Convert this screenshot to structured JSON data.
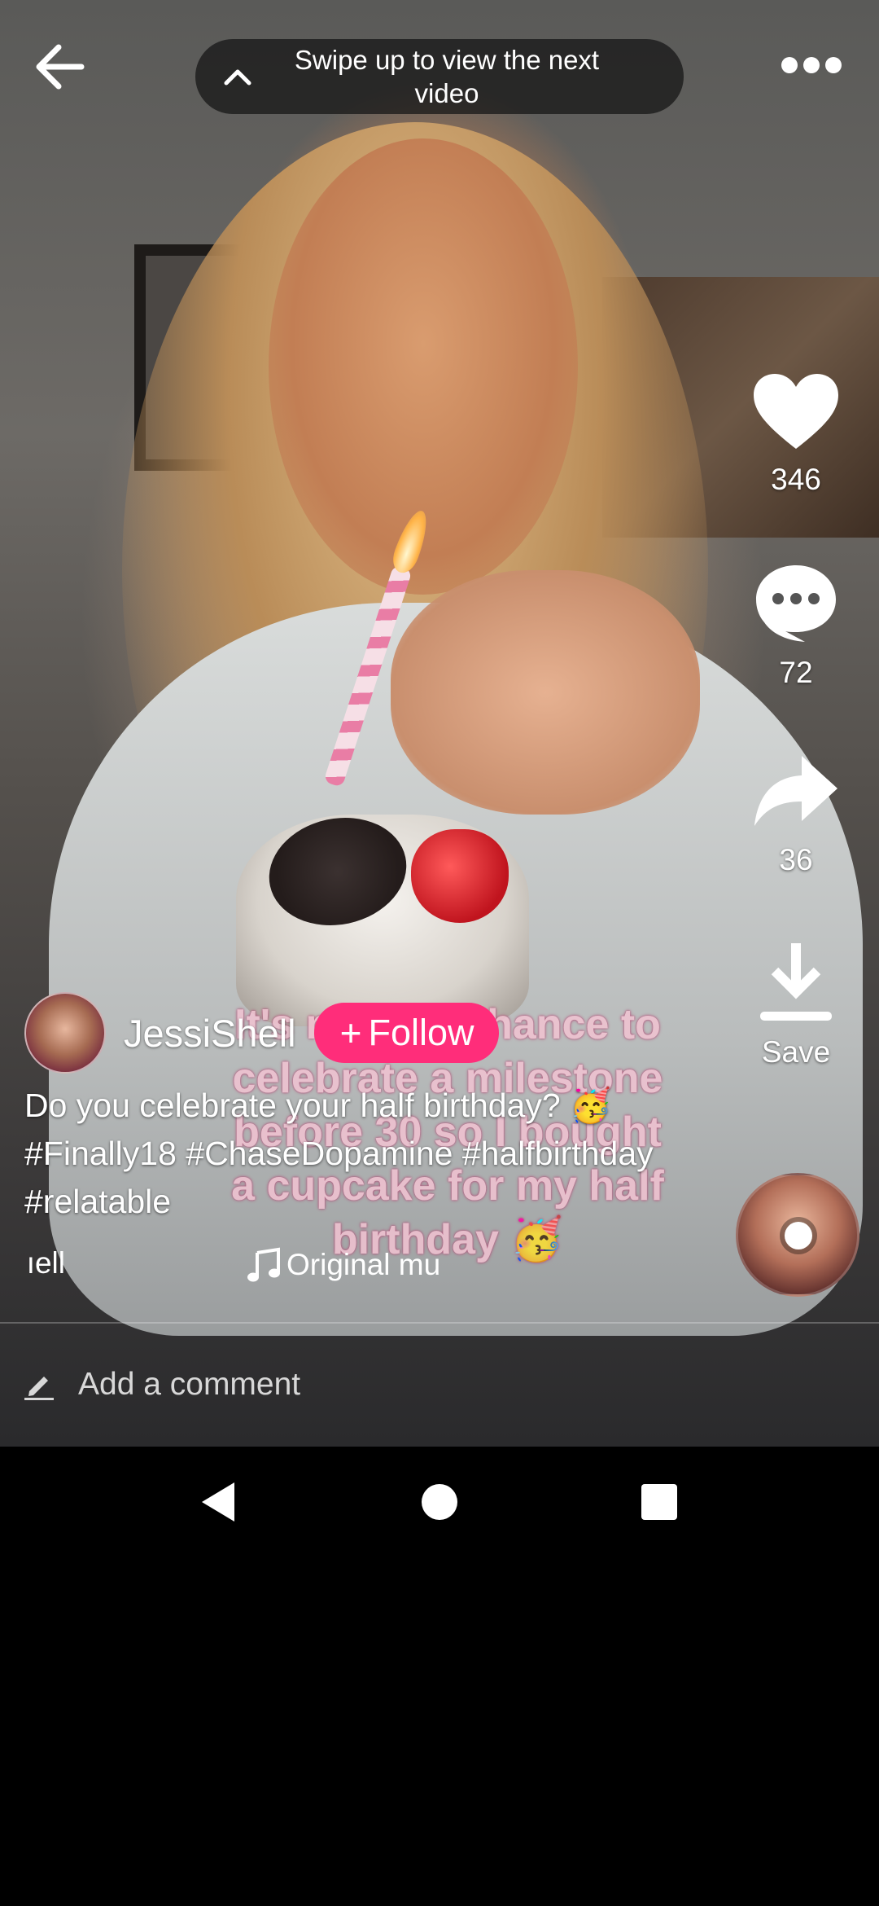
{
  "top_bar": {
    "swipe_hint": "Swipe up to view the next video"
  },
  "video": {
    "overlay_caption": "It's my last chance to celebrate a milestone before 30 so I bought a cupcake for my half birthday 🥳"
  },
  "actions": {
    "likes": "346",
    "comments": "72",
    "shares": "36",
    "save_label": "Save"
  },
  "author": {
    "name": "JessiShell",
    "follow_label": "Follow"
  },
  "description": "Do you celebrate your half birthday? 🥳 #Finally18 #ChaseDopamine #halfbirthday #relatable",
  "music": {
    "author_fragment": "ıell",
    "title_fragment": "Original mu"
  },
  "comment": {
    "placeholder": "Add a comment"
  },
  "colors": {
    "follow_button": "#ff2d7a",
    "overlay_caption": "#f2c3d2"
  }
}
